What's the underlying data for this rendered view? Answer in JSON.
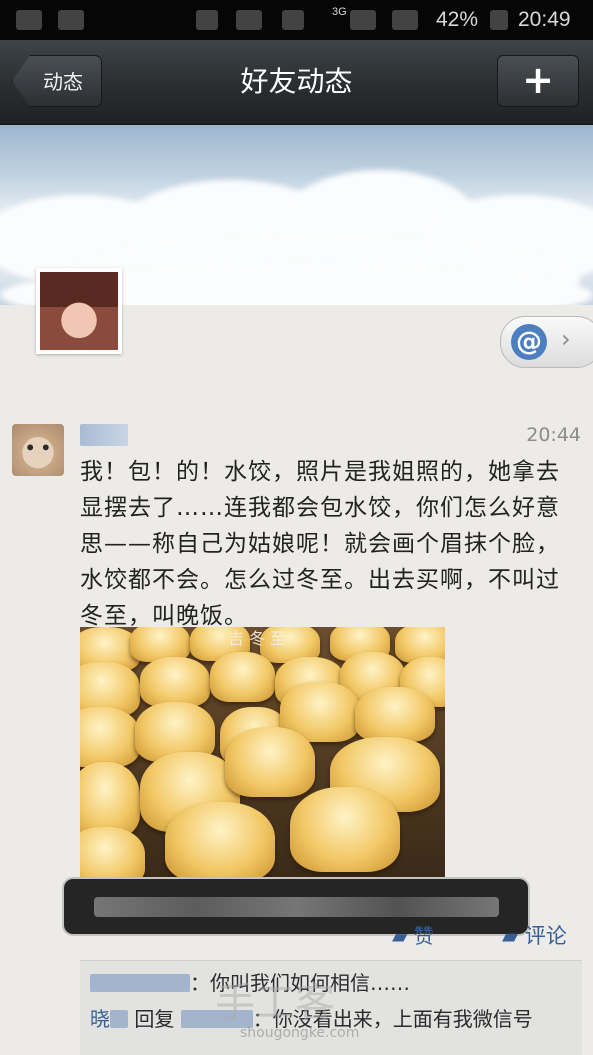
{
  "status_bar": {
    "network": "3G",
    "battery": "42%",
    "time": "20:49"
  },
  "nav": {
    "back_label": "动态",
    "title": "好友动态",
    "add_label": "+"
  },
  "profile": {
    "mention_icon": "at-icon",
    "mention_symbol": "@",
    "chevron": "›"
  },
  "post": {
    "time": "20:44",
    "text": "我！包！的！水饺，照片是我姐照的，她拿去显摆去了……连我都会包水饺，你们怎么好意思——称自己为姑娘呢！就会画个眉抹个脸，水饺都不会。怎么过冬至。出去买啊，不叫过冬至，叫晚饭。",
    "image_caption": "吉 冬 至"
  },
  "toast": {
    "text": ""
  },
  "actions": {
    "like_label": "赞",
    "comment_label": "评论"
  },
  "comments": [
    {
      "text": "：你叫我们如何相信……"
    },
    {
      "reply_from": "晓",
      "reply_word": "回复",
      "text": "：你没看出来，上面有我微信号"
    }
  ],
  "watermark": {
    "mark": "手工客",
    "url": "shougongke.com"
  },
  "colors": {
    "navbar": "#2a2e31",
    "link": "#3a5f93",
    "background": "#ecebe8"
  }
}
